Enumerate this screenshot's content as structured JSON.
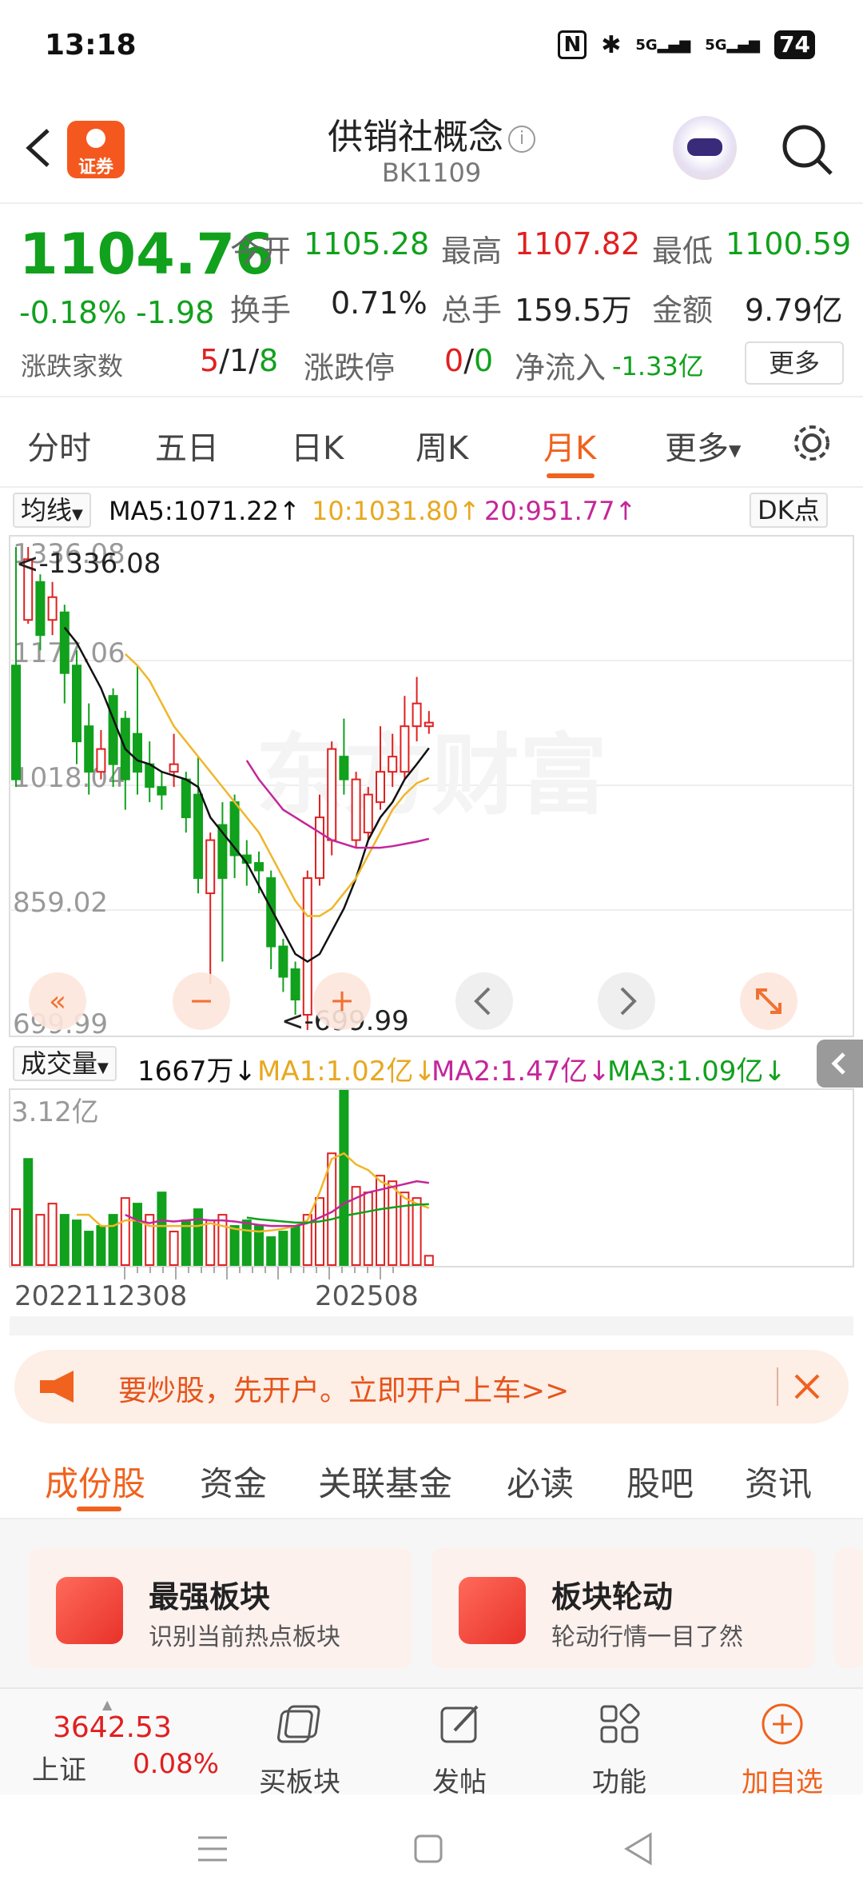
{
  "status_bar": {
    "time": "13:18",
    "nfc": "N",
    "bluetooth": "✱",
    "sig1": "5G",
    "sig2": "5G",
    "battery": "74"
  },
  "header": {
    "logo_text": "证券",
    "title": "供销社概念",
    "info_glyph": "i",
    "code": "BK1109"
  },
  "quote": {
    "price": "1104.76",
    "change_pct": "-0.18%",
    "change": "-1.98",
    "open_label": "今开",
    "open": "1105.28",
    "high_label": "最高",
    "high": "1107.82",
    "low_label": "最低",
    "low": "1100.59",
    "turnover_label": "换手",
    "turnover": "0.71%",
    "volume_label": "总手",
    "volume": "159.5万",
    "amount_label": "金额",
    "amount": "9.79亿",
    "breadth_label": "涨跌家数",
    "up": "5",
    "flat": "1",
    "down": "8",
    "slash": "/",
    "limit_label": "涨跌停",
    "limit_up": "0",
    "limit_down": "0",
    "netflow_label": "净流入",
    "netflow": "-1.33亿",
    "more": "更多"
  },
  "tabs": [
    "分时",
    "五日",
    "日K",
    "周K",
    "月K",
    "更多"
  ],
  "active_tab": "月K",
  "ma_bar": {
    "selector": "均线",
    "ma5": "MA5:1071.22↑",
    "ma10": "10:1031.80↑",
    "ma20": "20:951.77↑",
    "dk": "DK点"
  },
  "chart_labels": {
    "y1": "1336.08",
    "y2": "1177.06",
    "y3": "1018.04",
    "y4": "859.02",
    "y5": "699.99",
    "max_tag": "<-1336.08",
    "min_tag": "<-699.99",
    "watermark": "东方财富"
  },
  "vol_bar": {
    "selector": "成交量",
    "vol": "1667万↓",
    "ma1": "MA1:1.02亿↓",
    "ma2": "MA2:1.47亿↓",
    "ma3": "MA3:1.09亿↓"
  },
  "vol_labels": {
    "top": "3.12亿",
    "date_left": "2022112308",
    "date_right": "202508"
  },
  "banner": {
    "text": "要炒股，先开户。立即开户上车>>"
  },
  "bottom_tabs": [
    "成份股",
    "资金",
    "关联基金",
    "必读",
    "股吧",
    "资讯"
  ],
  "cards": [
    {
      "title": "最强板块",
      "subtitle": "识别当前热点板块"
    },
    {
      "title": "板块轮动",
      "subtitle": "轮动行情一目了然"
    }
  ],
  "toolbar": {
    "index_value": "3642.53",
    "index_name": "上证",
    "index_change": "0.08%",
    "buy": "买板块",
    "post": "发帖",
    "func": "功能",
    "add": "加自选"
  },
  "colors": {
    "up": "#e02020",
    "down": "#11a11d",
    "accent": "#f0621e",
    "ma5": "#111111",
    "ma10": "#f0b62a",
    "ma20": "#c4269a"
  },
  "chart_data": {
    "type": "candlestick",
    "period": "monthly",
    "ylim": [
      699.99,
      1336.08
    ],
    "yticks": [
      1336.08,
      1177.06,
      1018.04,
      859.02,
      699.99
    ],
    "candles": [
      {
        "o": 1180,
        "c": 1030,
        "h": 1336.08,
        "l": 1020
      },
      {
        "o": 1240,
        "c": 1320,
        "h": 1336.08,
        "l": 1235
      },
      {
        "o": 1290,
        "c": 1220,
        "h": 1300,
        "l": 1200
      },
      {
        "o": 1240,
        "c": 1270,
        "h": 1290,
        "l": 1220
      },
      {
        "o": 1250,
        "c": 1170,
        "h": 1260,
        "l": 1130
      },
      {
        "o": 1180,
        "c": 1080,
        "h": 1200,
        "l": 1050
      },
      {
        "o": 1100,
        "c": 1040,
        "h": 1130,
        "l": 1010
      },
      {
        "o": 1040,
        "c": 1070,
        "h": 1095,
        "l": 1030
      },
      {
        "o": 1140,
        "c": 1050,
        "h": 1150,
        "l": 1020
      },
      {
        "o": 1110,
        "c": 1030,
        "h": 1120,
        "l": 990
      },
      {
        "o": 1090,
        "c": 1040,
        "h": 1180,
        "l": 1010
      },
      {
        "o": 1050,
        "c": 1020,
        "h": 1080,
        "l": 1000
      },
      {
        "o": 1020,
        "c": 1010,
        "h": 1040,
        "l": 990
      },
      {
        "o": 1040,
        "c": 1050,
        "h": 1090,
        "l": 1020
      },
      {
        "o": 1030,
        "c": 980,
        "h": 1040,
        "l": 960
      },
      {
        "o": 1010,
        "c": 900,
        "h": 1060,
        "l": 880
      },
      {
        "o": 880,
        "c": 950,
        "h": 960,
        "l": 760
      },
      {
        "o": 970,
        "c": 900,
        "h": 1000,
        "l": 790
      },
      {
        "o": 1000,
        "c": 930,
        "h": 1010,
        "l": 900
      },
      {
        "o": 930,
        "c": 920,
        "h": 950,
        "l": 890
      },
      {
        "o": 920,
        "c": 910,
        "h": 935,
        "l": 880
      },
      {
        "o": 900,
        "c": 810,
        "h": 910,
        "l": 780
      },
      {
        "o": 810,
        "c": 770,
        "h": 820,
        "l": 750
      },
      {
        "o": 780,
        "c": 740,
        "h": 790,
        "l": 720
      },
      {
        "o": 720,
        "c": 900,
        "h": 910,
        "l": 699.99
      },
      {
        "o": 900,
        "c": 980,
        "h": 1010,
        "l": 890
      },
      {
        "o": 950,
        "c": 1070,
        "h": 1080,
        "l": 930
      },
      {
        "o": 1060,
        "c": 1030,
        "h": 1110,
        "l": 1010
      },
      {
        "o": 950,
        "c": 1030,
        "h": 1040,
        "l": 940
      },
      {
        "o": 960,
        "c": 1010,
        "h": 1020,
        "l": 950
      },
      {
        "o": 1000,
        "c": 1040,
        "h": 1100,
        "l": 990
      },
      {
        "o": 1040,
        "c": 1060,
        "h": 1090,
        "l": 1020
      },
      {
        "o": 1040,
        "c": 1100,
        "h": 1140,
        "l": 1030
      },
      {
        "o": 1100,
        "c": 1130,
        "h": 1165,
        "l": 1080
      },
      {
        "o": 1100,
        "c": 1104.76,
        "h": 1120,
        "l": 1090
      }
    ],
    "ma5": [
      null,
      null,
      null,
      null,
      1230,
      1210,
      1180,
      1150,
      1110,
      1070,
      1055,
      1050,
      1040,
      1035,
      1030,
      1020,
      980,
      960,
      940,
      920,
      890,
      860,
      830,
      800,
      790,
      800,
      830,
      860,
      900,
      950,
      980,
      1000,
      1030,
      1050,
      1071.22
    ],
    "ma10": [
      null,
      null,
      null,
      null,
      null,
      null,
      null,
      null,
      null,
      1195,
      1180,
      1160,
      1130,
      1100,
      1080,
      1060,
      1040,
      1020,
      1000,
      980,
      960,
      930,
      900,
      870,
      850,
      850,
      860,
      880,
      900,
      930,
      960,
      990,
      1010,
      1025,
      1031.8
    ],
    "ma20": [
      null,
      null,
      null,
      null,
      null,
      null,
      null,
      null,
      null,
      null,
      null,
      null,
      null,
      null,
      null,
      null,
      null,
      null,
      null,
      1055,
      1030,
      1010,
      990,
      980,
      970,
      960,
      950,
      945,
      940,
      940,
      940,
      942,
      945,
      948,
      951.77
    ],
    "volume": [
      1.0,
      1.9,
      0.9,
      1.1,
      0.9,
      0.8,
      0.6,
      0.7,
      0.9,
      1.2,
      1.1,
      0.9,
      1.3,
      0.6,
      0.8,
      1.0,
      0.8,
      0.9,
      0.7,
      0.8,
      0.7,
      0.5,
      0.6,
      0.7,
      0.9,
      1.2,
      2.0,
      3.12,
      1.4,
      1.3,
      1.6,
      1.5,
      1.3,
      1.2,
      0.1667
    ],
    "vol_up": [
      true,
      false,
      true,
      true,
      false,
      false,
      false,
      false,
      false,
      true,
      false,
      true,
      false,
      true,
      false,
      false,
      true,
      true,
      false,
      false,
      false,
      false,
      false,
      false,
      true,
      true,
      true,
      false,
      true,
      true,
      true,
      true,
      true,
      true,
      true
    ],
    "vol_ma1": [
      null,
      null,
      null,
      null,
      null,
      0.9,
      0.9,
      0.7,
      0.7,
      0.8,
      0.8,
      0.7,
      0.7,
      0.7,
      0.7,
      0.7,
      0.75,
      0.7,
      0.65,
      0.62,
      0.6,
      0.62,
      0.65,
      0.7,
      0.8,
      1.3,
      1.9,
      2.0,
      1.8,
      1.7,
      1.5,
      1.4,
      1.2,
      1.1,
      1.02
    ],
    "vol_ma2": [
      null,
      null,
      null,
      null,
      null,
      null,
      null,
      null,
      null,
      0.9,
      0.8,
      0.75,
      0.8,
      0.78,
      0.8,
      0.82,
      0.8,
      0.8,
      0.78,
      0.75,
      0.72,
      0.7,
      0.7,
      0.7,
      0.75,
      0.85,
      0.95,
      1.1,
      1.2,
      1.3,
      1.35,
      1.4,
      1.45,
      1.5,
      1.47
    ],
    "vol_ma3": [
      null,
      null,
      null,
      null,
      null,
      null,
      null,
      null,
      null,
      null,
      null,
      null,
      null,
      null,
      null,
      null,
      null,
      null,
      null,
      0.85,
      0.82,
      0.8,
      0.78,
      0.76,
      0.76,
      0.78,
      0.82,
      0.88,
      0.92,
      0.96,
      1.0,
      1.03,
      1.06,
      1.08,
      1.09
    ]
  }
}
